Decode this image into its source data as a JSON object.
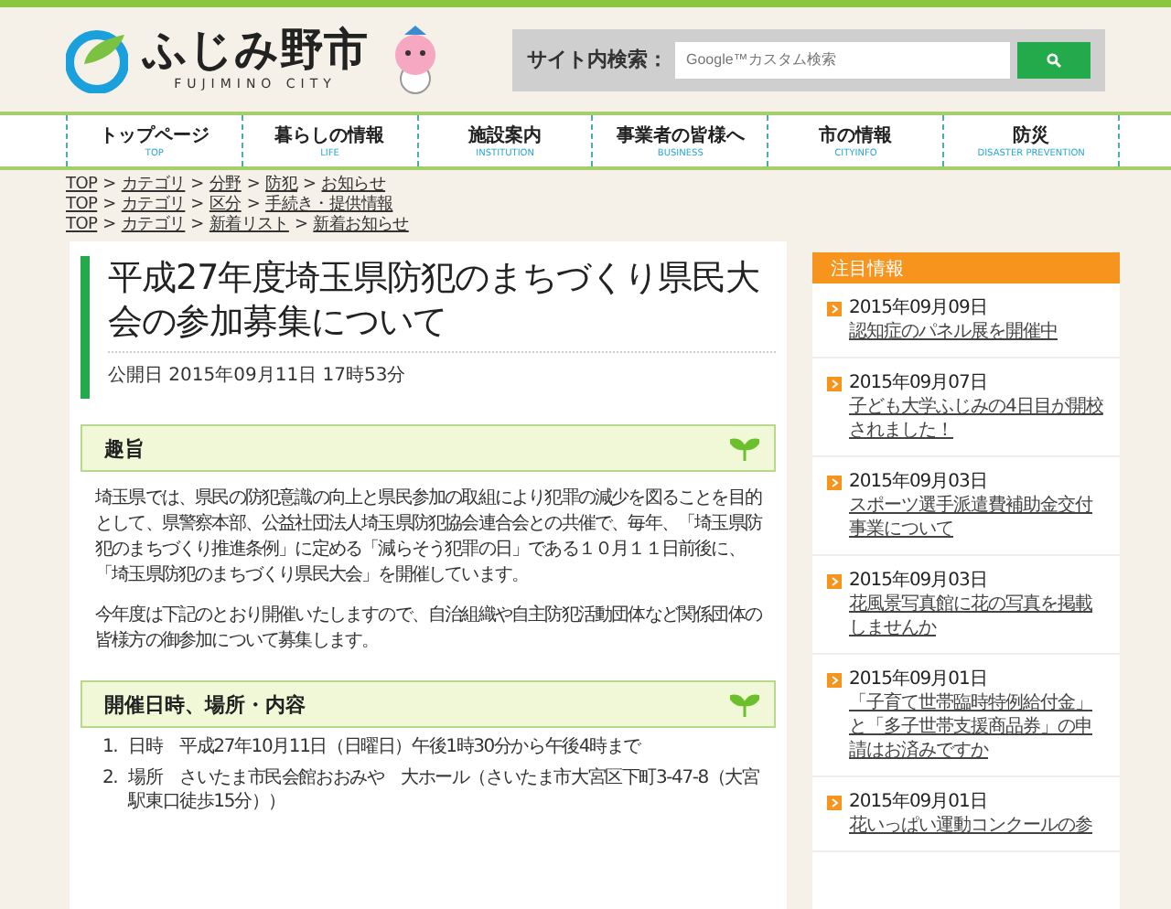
{
  "header": {
    "logo_text": "ふじみ野市",
    "logo_sub": "FUJIMINO CITY",
    "search_label": "サイト内検索：",
    "search_placeholder": "Google™カスタム検索"
  },
  "nav": [
    {
      "label": "トップページ",
      "sub": "TOP"
    },
    {
      "label": "暮らしの情報",
      "sub": "LIFE"
    },
    {
      "label": "施設案内",
      "sub": "INSTITUTION"
    },
    {
      "label": "事業者の皆様へ",
      "sub": "BUSINESS"
    },
    {
      "label": "市の情報",
      "sub": "CITYINFO"
    },
    {
      "label": "防災",
      "sub": "DISASTER PREVENTION"
    }
  ],
  "breadcrumbs": [
    {
      "separator": ">",
      "links": [
        "TOP",
        "カテゴリ",
        "分野",
        "防犯",
        "お知らせ"
      ]
    },
    {
      "separator": ">",
      "links": [
        "TOP",
        "カテゴリ",
        "区分",
        "手続き・提供情報"
      ]
    },
    {
      "separator": ">",
      "links": [
        "TOP",
        "カテゴリ",
        "新着リスト",
        "新着お知らせ"
      ]
    }
  ],
  "article": {
    "title": "平成27年度埼玉県防犯のまちづくり県民大会の参加募集について",
    "published": "公開日 2015年09月11日 17時53分",
    "sections": [
      {
        "heading": "趣旨",
        "paragraphs": [
          "埼玉県では、県民の防犯意識の向上と県民参加の取組により犯罪の減少を図ることを目的として、県警察本部、公益社団法人埼玉県防犯協会連合会との共催で、毎年、「埼玉県防犯のまちづくり推進条例」に定める「減らそう犯罪の日」である１０月１１日前後に、「埼玉県防犯のまちづくり県民大会」を開催しています。",
          "今年度は下記のとおり開催いたしますので、自治組織や自主防犯活動団体など関係団体の皆様方の御参加について募集します。"
        ]
      },
      {
        "heading": "開催日時、場所・内容",
        "list": [
          {
            "number": "1.",
            "text": "日時　平成27年10月11日（日曜日）午後1時30分から午後4時まで"
          },
          {
            "number": "2.",
            "text": "場所　さいたま市民会館おおみや　大ホール（さいたま市大宮区下町3-47-8（大宮駅東口徒歩15分））"
          }
        ]
      }
    ]
  },
  "sidebar": {
    "title": "注目情報",
    "items": [
      {
        "date": "2015年09月09日",
        "title": "認知症のパネル展を開催中"
      },
      {
        "date": "2015年09月07日",
        "title": "子ども大学ふじみの4日目が開校されました！"
      },
      {
        "date": "2015年09月03日",
        "title": "スポーツ選手派遣費補助金交付事業について"
      },
      {
        "date": "2015年09月03日",
        "title": "花風景写真館に花の写真を掲載しませんか"
      },
      {
        "date": "2015年09月01日",
        "title": "「子育て世帯臨時特例給付金」と「多子世帯支援商品券」の申請はお済みですか"
      },
      {
        "date": "2015年09月01日",
        "title": "花いっぱい運動コンクールの参"
      }
    ]
  }
}
